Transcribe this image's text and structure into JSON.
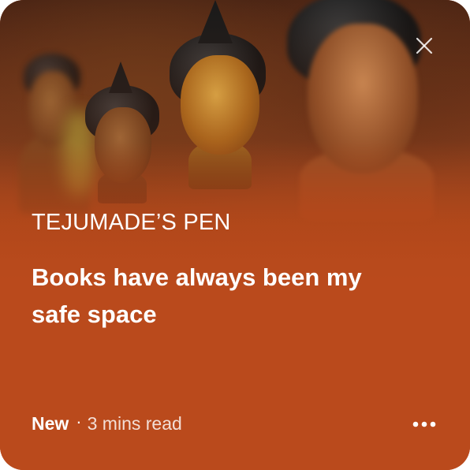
{
  "card": {
    "publication": "TEJUMADE’S PEN",
    "title_line_1": "Books have always been my",
    "title_line_2": "safe space",
    "badge": "New",
    "separator": "·",
    "read_time": "3 mins read"
  },
  "icons": {
    "close": "close-icon",
    "more": "more-options-icon"
  },
  "colors": {
    "card_background": "#ba4a1c",
    "text": "#ffffff"
  }
}
